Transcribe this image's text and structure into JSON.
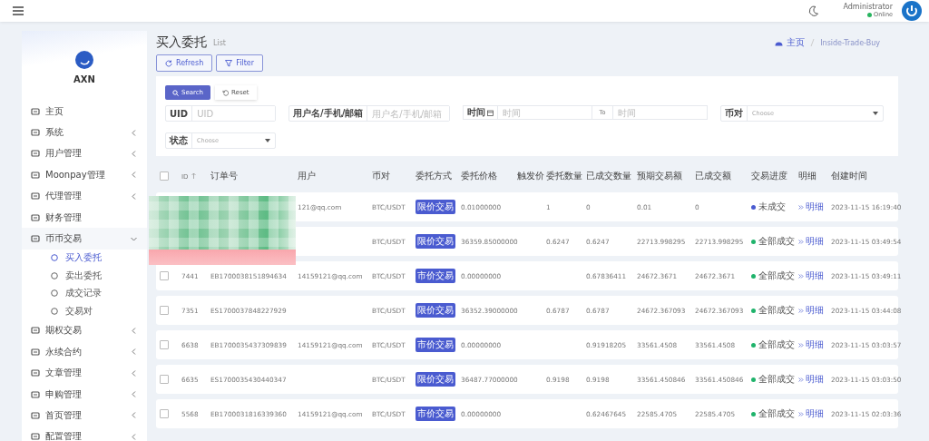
{
  "header": {
    "user": {
      "name": "Administrator",
      "status": "Online",
      "online": true
    }
  },
  "sidebar": {
    "brand": "AXN",
    "items": [
      {
        "label": "主页",
        "expandable": false
      },
      {
        "label": "系统",
        "expandable": true,
        "expanded": false
      },
      {
        "label": "用户管理",
        "expandable": true,
        "expanded": false
      },
      {
        "label": "Moonpay管理",
        "expandable": true,
        "expanded": false
      },
      {
        "label": "代理管理",
        "expandable": true,
        "expanded": false
      },
      {
        "label": "财务管理",
        "expandable": false
      },
      {
        "label": "币币交易",
        "expandable": true,
        "expanded": true,
        "children": [
          {
            "label": "买入委托",
            "selected": true
          },
          {
            "label": "卖出委托",
            "selected": false
          },
          {
            "label": "成交记录",
            "selected": false
          },
          {
            "label": "交易对",
            "selected": false
          }
        ]
      },
      {
        "label": "期权交易",
        "expandable": true,
        "expanded": false
      },
      {
        "label": "永续合约",
        "expandable": true,
        "expanded": false
      },
      {
        "label": "文章管理",
        "expandable": true,
        "expanded": false
      },
      {
        "label": "申购管理",
        "expandable": true,
        "expanded": false
      },
      {
        "label": "首页管理",
        "expandable": true,
        "expanded": false
      },
      {
        "label": "配置管理",
        "expandable": true,
        "expanded": false
      }
    ]
  },
  "page": {
    "title": "买入委托",
    "subtitle": "List",
    "breadcrumb": [
      "主页",
      "Inside-Trade-Buy"
    ]
  },
  "toolbar": [
    "Refresh",
    "Filter"
  ],
  "filters": {
    "search": "Search",
    "reset": "Reset",
    "fields": [
      {
        "kind": "text",
        "label": "UID",
        "placeholder": "UID"
      },
      {
        "kind": "text",
        "label": "用户名/手机/邮箱",
        "placeholder": "用户名/手机/邮箱"
      },
      {
        "kind": "range",
        "label": "时间",
        "placeholder": "时间",
        "separator": "To",
        "placeholder_end": "时间"
      },
      {
        "kind": "select",
        "label": "币对",
        "value": "Choose"
      },
      {
        "kind": "select",
        "label": "状态",
        "value": "Choose"
      }
    ]
  },
  "table": {
    "all_checked": false,
    "columns": [
      "ID",
      "订单号",
      "用户",
      "币对",
      "委托方式",
      "委托价格",
      "触发价",
      "委托数量",
      "已成交数量",
      "预期交易额",
      "已成交额",
      "交易进度",
      "明细",
      "创建时间"
    ],
    "rows": [
      {
        "user": "121@qq.com",
        "pair": "BTC/USDT",
        "type": "限价交易",
        "price": "0.01000000",
        "quantity": "1",
        "filled_qty": "0",
        "expected": "0.01",
        "filled_amount": "0",
        "progress": "未成交",
        "color": "#4a5bd0",
        "detail": "明细",
        "created": "2023-11-15 16:19:40"
      },
      {
        "pair": "BTC/USDT",
        "type": "限价交易",
        "price": "36359.85000000",
        "quantity": "0.6247",
        "filled_qty": "0.6247",
        "expected": "22713.998295",
        "filled_amount": "22713.998295",
        "progress": "全部成交",
        "color": "#1fb36b",
        "detail": "明细",
        "created": "2023-11-15 03:49:54"
      },
      {
        "checked": false,
        "id": "7441",
        "order_no": "EB1700038151894634",
        "user": "14159121@qq.com",
        "pair": "BTC/USDT",
        "type": "市价交易",
        "price": "0.00000000",
        "filled_qty": "0.67836411",
        "expected": "24672.3671",
        "filled_amount": "24672.3671",
        "progress": "全部成交",
        "color": "#1fb36b",
        "detail": "明细",
        "created": "2023-11-15 03:49:11"
      },
      {
        "checked": false,
        "id": "7351",
        "order_no": "ES1700037848227929",
        "pair": "BTC/USDT",
        "type": "限价交易",
        "price": "36352.39000000",
        "quantity": "0.6787",
        "filled_qty": "0.6787",
        "expected": "24672.367093",
        "filled_amount": "24672.367093",
        "progress": "全部成交",
        "color": "#1fb36b",
        "detail": "明细",
        "created": "2023-11-15 03:44:08"
      },
      {
        "checked": false,
        "id": "6638",
        "order_no": "EB1700035437309839",
        "user": "14159121@qq.com",
        "pair": "BTC/USDT",
        "type": "市价交易",
        "price": "0.00000000",
        "filled_qty": "0.91918205",
        "expected": "33561.4508",
        "filled_amount": "33561.4508",
        "progress": "全部成交",
        "color": "#1fb36b",
        "detail": "明细",
        "created": "2023-11-15 03:03:57"
      },
      {
        "checked": false,
        "id": "6635",
        "order_no": "ES1700035430440347",
        "pair": "BTC/USDT",
        "type": "限价交易",
        "price": "36487.77000000",
        "quantity": "0.9198",
        "filled_qty": "0.9198",
        "expected": "33561.450846",
        "filled_amount": "33561.450846",
        "progress": "全部成交",
        "color": "#1fb36b",
        "detail": "明细",
        "created": "2023-11-15 03:03:50"
      },
      {
        "checked": false,
        "id": "5568",
        "order_no": "EB1700031816339360",
        "user": "14159121@qq.com",
        "pair": "BTC/USDT",
        "type": "市价交易",
        "price": "0.00000000",
        "filled_qty": "0.62467645",
        "expected": "22585.4705",
        "filled_amount": "22585.4705",
        "progress": "全部成交",
        "color": "#1fb36b",
        "detail": "明细",
        "created": "2023-11-15 02:03:36"
      }
    ]
  }
}
